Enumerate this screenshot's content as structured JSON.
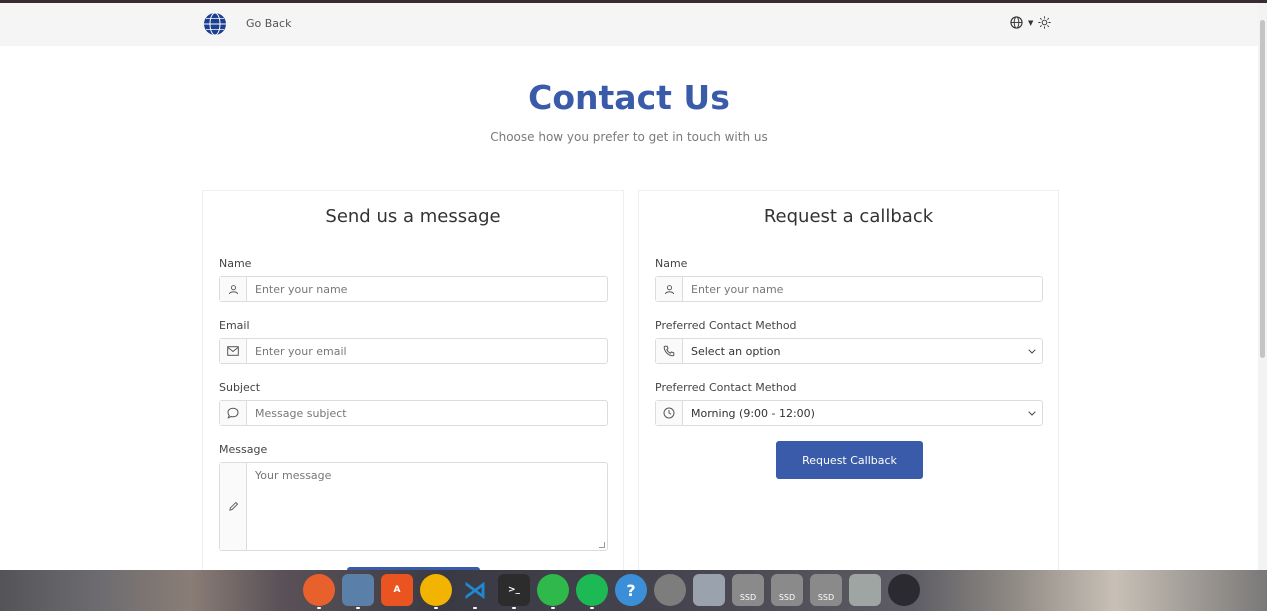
{
  "nav": {
    "go_back": "Go Back"
  },
  "header": {
    "title": "Contact Us",
    "subtitle": "Choose how you prefer to get in touch with us"
  },
  "message_form": {
    "heading": "Send us a message",
    "name_label": "Name",
    "name_placeholder": "Enter your name",
    "email_label": "Email",
    "email_placeholder": "Enter your email",
    "subject_label": "Subject",
    "subject_placeholder": "Message subject",
    "message_label": "Message",
    "message_placeholder": "Your message"
  },
  "callback_form": {
    "heading": "Request a callback",
    "name_label": "Name",
    "name_placeholder": "Enter your name",
    "method_label": "Preferred Contact Method",
    "method_value": "Select an option",
    "time_label": "Preferred Contact Method",
    "time_value": "Morning (9:00 - 12:00)",
    "submit_label": "Request Callback"
  },
  "dock": {
    "items": [
      {
        "name": "firefox-icon",
        "color": "#e8612c",
        "text": ""
      },
      {
        "name": "files-icon",
        "color": "#5a7fa8",
        "text": ""
      },
      {
        "name": "app-center-icon",
        "color": "#e95420",
        "text": "A"
      },
      {
        "name": "chrome-icon",
        "color": "#f2b400",
        "text": ""
      },
      {
        "name": "vscode-icon",
        "color": "#1f8ad2",
        "text": ""
      },
      {
        "name": "terminal-icon",
        "color": "#2c2c2c",
        "text": ">_"
      },
      {
        "name": "whatsapp-icon",
        "color": "#2fb94a",
        "text": ""
      },
      {
        "name": "spotify-icon",
        "color": "#1db954",
        "text": ""
      },
      {
        "name": "help-icon",
        "color": "#3b8fd9",
        "text": "?"
      },
      {
        "name": "settings-icon",
        "color": "#7d7d7d",
        "text": ""
      },
      {
        "name": "image-viewer-icon",
        "color": "#9aa3ad",
        "text": ""
      },
      {
        "name": "ssd-drive-icon",
        "color": "#8a8a8a",
        "text": "SSD"
      },
      {
        "name": "ssd-drive-icon",
        "color": "#8a8a8a",
        "text": "SSD"
      },
      {
        "name": "ssd-drive-icon",
        "color": "#8a8a8a",
        "text": "SSD"
      },
      {
        "name": "trash-icon",
        "color": "#9fa5a2",
        "text": ""
      },
      {
        "name": "show-apps-icon",
        "color": "#2a2a30",
        "text": ""
      }
    ]
  },
  "colors": {
    "accent": "#3a5ba9"
  }
}
